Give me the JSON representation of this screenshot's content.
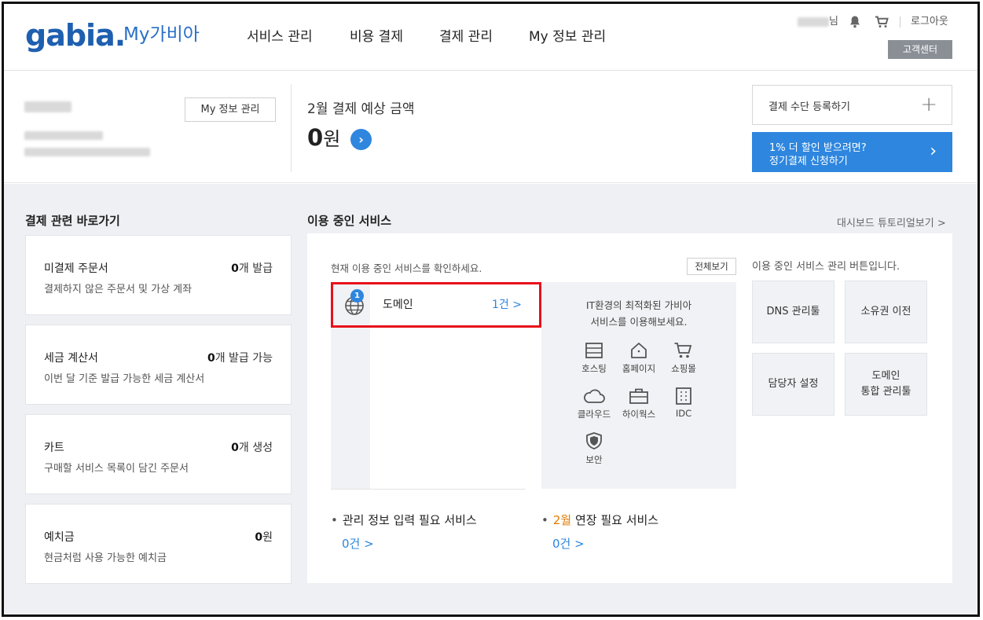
{
  "header": {
    "logo": "gabia.",
    "logo_sub": "My가비아",
    "nav": [
      "서비스 관리",
      "비용 결제",
      "결제 관리",
      "My 정보 관리"
    ],
    "user_suffix": "님",
    "logout": "로그아웃",
    "customer_center": "고객센터"
  },
  "profile": {
    "my_info_button": "My 정보 관리"
  },
  "billing": {
    "label": "2월 결제 예상 금액",
    "amount": "0",
    "unit": "원"
  },
  "payment": {
    "register": "결제 수단 등록하기",
    "plus": "+",
    "discount_line1": "1% 더 할인 받으려면?",
    "discount_line2": "정기결제 신청하기",
    "arrow": "›"
  },
  "shortcuts": {
    "title": "결제 관련 바로가기",
    "cards": [
      {
        "title": "미결제 주문서",
        "value": "0",
        "value_suffix": "개 발급",
        "desc": "결제하지 않은 주문서 및 가상 계좌"
      },
      {
        "title": "세금 계산서",
        "value": "0",
        "value_suffix": "개 발급 가능",
        "desc": "이번 달 기준 발급 가능한 세금 계산서"
      },
      {
        "title": "카트",
        "value": "0",
        "value_suffix": "개 생성",
        "desc": "구매할 서비스 목록이 담긴 주문서"
      },
      {
        "title": "예치금",
        "value": "0",
        "value_suffix": "원",
        "desc": "현금처럼 사용 가능한 예치금"
      }
    ]
  },
  "services": {
    "title": "이용 중인 서비스",
    "tutorial": "대시보드 튜토리얼보기 >",
    "desc": "현재 이용 중인 서비스를 확인하세요.",
    "view_all": "전체보기",
    "item": {
      "badge": "1",
      "name": "도메인",
      "count": "1건 >"
    },
    "recommend_line1": "IT환경의 최적화된 가비아",
    "recommend_line2": "서비스를 이용해보세요.",
    "recommend_icons": [
      {
        "icon": "hosting-icon",
        "label": "호스팅"
      },
      {
        "icon": "homepage-icon",
        "label": "홈페이지"
      },
      {
        "icon": "shopping-mall-icon",
        "label": "쇼핑몰"
      },
      {
        "icon": "cloud-icon",
        "label": "클라우드"
      },
      {
        "icon": "hiworks-icon",
        "label": "하이웍스"
      },
      {
        "icon": "idc-icon",
        "label": "IDC"
      },
      {
        "icon": "security-icon",
        "label": "보안"
      }
    ],
    "management_desc": "이용 중인 서비스 관리 버튼입니다.",
    "management_buttons": [
      "DNS 관리툴",
      "소유권 이전",
      "담당자 설정",
      "도메인\n통합 관리툴"
    ],
    "info_required": {
      "label": "관리 정보 입력 필요 서비스",
      "count": "0건 >"
    },
    "renewal": {
      "month": "2월",
      "label": " 연장 필요 서비스",
      "count": "0건 >"
    }
  },
  "colors": {
    "accent": "#2e86de",
    "highlight_border": "#e8101a",
    "renewal_month": "#e07b00"
  }
}
